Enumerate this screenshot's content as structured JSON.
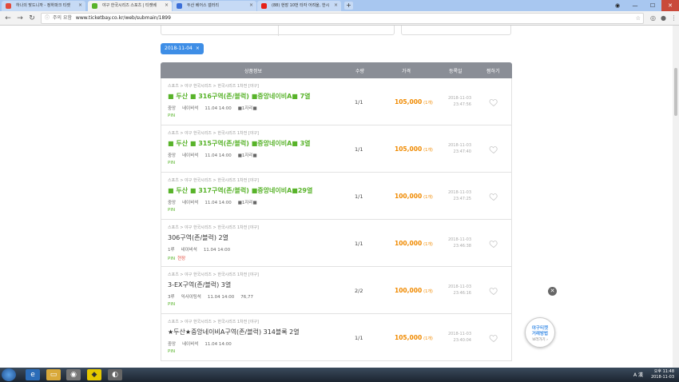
{
  "browser": {
    "tabs": [
      {
        "label": "하나의 맞드니까 - 정하파크 티켓",
        "active": false,
        "color": "#e24a3b"
      },
      {
        "label": "야구 한국시리즈 스포츠 | 티켓베",
        "active": true,
        "color": "#58b32a"
      },
      {
        "label": "두산 베어스 갤러리",
        "active": false,
        "color": "#3b6fd8"
      },
      {
        "label": "(88) 현장 10번 타자 어려울, 한시",
        "active": false,
        "color": "#e62117"
      }
    ],
    "security_label": "주의 요함",
    "url": "www.ticketbay.co.kr/web/submain/1899",
    "window": {
      "minimize": "—",
      "maximize": "☐",
      "close": "✕"
    }
  },
  "filter_chip": {
    "label": "2018-11-04",
    "close": "×"
  },
  "table": {
    "headers": {
      "info": "상품정보",
      "qty": "수량",
      "price": "가격",
      "date": "등록일",
      "save": "찜하기"
    },
    "rows": [
      {
        "crumb": "스포츠 > 야구 한국시리즈 > 한국시리즈 1차전 [야구]",
        "title": "■ 두산 ■ 316구역(존/블럭) ■중앙네이비A■ 7열",
        "style": "green",
        "meta": [
          "중앙",
          "네이비석",
          "11.04 14:00",
          "■1자리■"
        ],
        "tags": [
          "PIN"
        ],
        "qty": "1/1",
        "price": "105,000",
        "unit": "(1개)",
        "date": "2018-11-03",
        "time": "23:47:56"
      },
      {
        "crumb": "스포츠 > 야구 한국시리즈 > 한국시리즈 1차전 [야구]",
        "title": "■ 두산 ■ 315구역(존/블럭) ■중앙네이비A■ 3열",
        "style": "green",
        "meta": [
          "중앙",
          "네이비석",
          "11.04 14:00",
          "■1자리■"
        ],
        "tags": [
          "PIN"
        ],
        "qty": "1/1",
        "price": "105,000",
        "unit": "(1개)",
        "date": "2018-11-03",
        "time": "23:47:40"
      },
      {
        "crumb": "스포츠 > 야구 한국시리즈 > 한국시리즈 1차전 [야구]",
        "title": "■ 두산 ■ 317구역(존/블럭) ■중앙네이비A■29열",
        "style": "green",
        "meta": [
          "중앙",
          "네이비석",
          "11.04 14:00",
          "■1자리■"
        ],
        "tags": [
          "PIN"
        ],
        "qty": "1/1",
        "price": "100,000",
        "unit": "(1개)",
        "date": "2018-11-03",
        "time": "23:47:25"
      },
      {
        "crumb": "스포츠 > 야구 한국시리즈 > 한국시리즈 1차전 [야구]",
        "title": "306구역(존/블럭) 2열",
        "style": "dark",
        "meta": [
          "1루",
          "네이비석",
          "11.04 14:00"
        ],
        "tags": [
          "PIN",
          "현장"
        ],
        "qty": "1/1",
        "price": "100,000",
        "unit": "(1개)",
        "date": "2018-11-03",
        "time": "23:46:38"
      },
      {
        "crumb": "스포츠 > 야구 한국시리즈 > 한국시리즈 1차전 [야구]",
        "title": "3-EX구역(존/블럭) 3열",
        "style": "dark",
        "meta": [
          "3루",
          "익사이팅석",
          "11.04 14:00",
          "76,77"
        ],
        "tags": [
          "PIN"
        ],
        "qty": "2/2",
        "price": "100,000",
        "unit": "(1개)",
        "date": "2018-11-03",
        "time": "23:46:16"
      },
      {
        "crumb": "스포츠 > 야구 한국시리즈 > 한국시리즈 1차전 [야구]",
        "title": "★두산★중앙네이비A구역(존/블럭) 314블록 2열",
        "style": "dark",
        "meta": [
          "중앙",
          "네이비석",
          "11.04 14:00"
        ],
        "tags": [
          "PIN"
        ],
        "qty": "1/1",
        "price": "105,000",
        "unit": "(1개)",
        "date": "2018-11-03",
        "time": "23:40:04"
      }
    ]
  },
  "floater": {
    "line1": "야구티켓",
    "line2": "거래방법",
    "line3": "보러가기 ›",
    "close": "✕"
  },
  "taskbar": {
    "time": "오후 11:48",
    "date": "2018-11-03",
    "ime": "A 漢"
  }
}
